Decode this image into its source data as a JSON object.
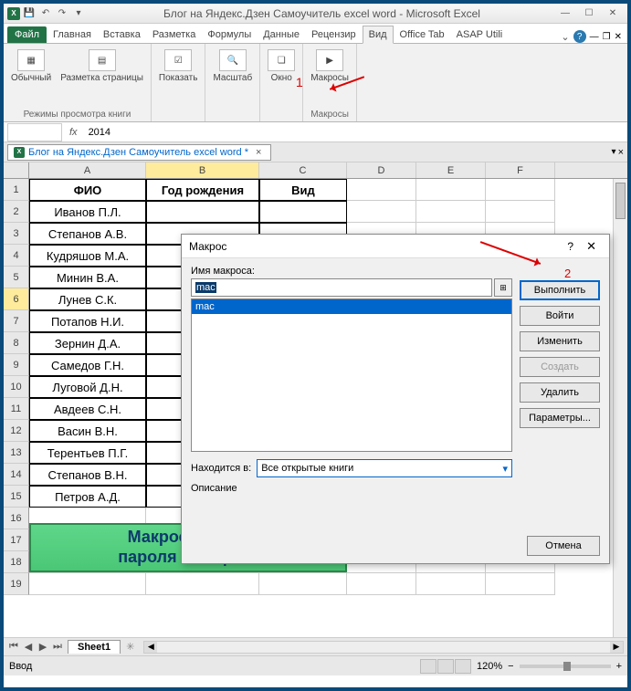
{
  "title": "Блог на Яндекс.Дзен Самоучитель excel word  -  Microsoft Excel",
  "ribbon": {
    "file": "Файл",
    "tabs": [
      "Главная",
      "Вставка",
      "Разметка",
      "Формулы",
      "Данные",
      "Рецензир",
      "Вид",
      "Office Tab",
      "ASAP Utili"
    ],
    "active": "Вид",
    "groups": {
      "views": {
        "normal": "Обычный",
        "page": "Разметка страницы",
        "label": "Режимы просмотра книги"
      },
      "show": {
        "label": "Показать"
      },
      "zoom": {
        "label": "Масштаб"
      },
      "window": {
        "label": "Окно"
      },
      "macros": {
        "btn": "Макросы",
        "label": "Макросы"
      }
    }
  },
  "formula": {
    "fx": "fx",
    "value": "2014"
  },
  "doctab": {
    "name": "Блог на Яндекс.Дзен Самоучитель excel word *"
  },
  "columns": [
    "A",
    "B",
    "C",
    "D",
    "E",
    "F"
  ],
  "headers": {
    "a": "ФИО",
    "b": "Год рождения",
    "c": "Вид"
  },
  "rows": [
    "Иванов П.Л.",
    "Степанов А.В.",
    "Кудряшов М.А.",
    "Минин В.А.",
    "Лунев С.К.",
    "Потапов Н.И.",
    "Зернин Д.А.",
    "Самедов Г.Н.",
    "Луговой Д.Н.",
    "Авдеев С.Н.",
    "Васин В.Н.",
    "Терентьев П.Г.",
    "Степанов В.Н.",
    "Петров А.Д."
  ],
  "banner": {
    "l1": "Макрос снятия",
    "l2": "пароля с защиты"
  },
  "sheet": {
    "name": "Sheet1"
  },
  "status": {
    "mode": "Ввод",
    "zoom": "120%"
  },
  "dialog": {
    "title": "Макрос",
    "name_label": "Имя макроса:",
    "input": "mac",
    "list_item": "mac",
    "location_label": "Находится в:",
    "location_value": "Все открытые книги",
    "desc_label": "Описание",
    "buttons": {
      "run": "Выполнить",
      "step": "Войти",
      "edit": "Изменить",
      "create": "Создать",
      "delete": "Удалить",
      "options": "Параметры...",
      "cancel": "Отмена"
    }
  },
  "annotations": {
    "a1": "1",
    "a2": "2"
  }
}
